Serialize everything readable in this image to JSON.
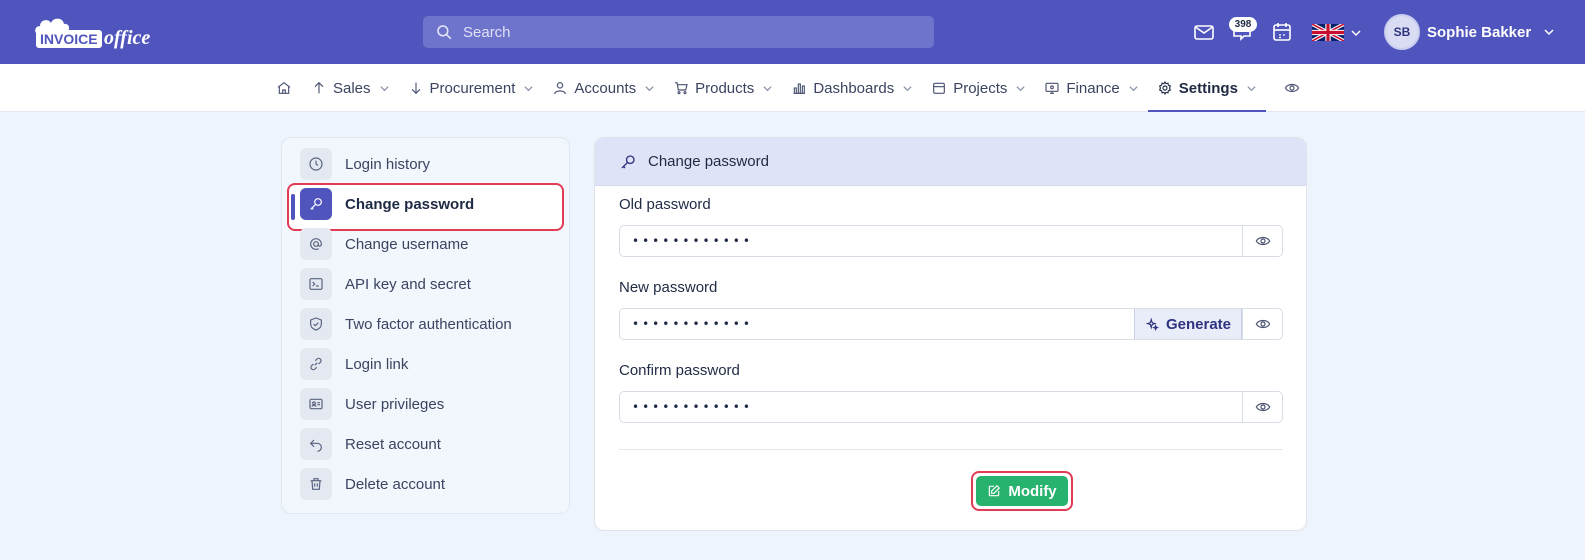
{
  "app": {
    "logo_text_a": "INVOICE",
    "logo_text_b": "office"
  },
  "topbar": {
    "search_placeholder": "Search",
    "notification_count": "398",
    "language": "en-GB",
    "user": {
      "initials": "SB",
      "name": "Sophie Bakker"
    }
  },
  "nav": {
    "items": [
      {
        "label": "Sales",
        "icon": "arrow-up-icon"
      },
      {
        "label": "Procurement",
        "icon": "arrow-down-icon"
      },
      {
        "label": "Accounts",
        "icon": "user-icon"
      },
      {
        "label": "Products",
        "icon": "cart-icon"
      },
      {
        "label": "Dashboards",
        "icon": "bar-chart-icon"
      },
      {
        "label": "Projects",
        "icon": "calendar-icon"
      },
      {
        "label": "Finance",
        "icon": "monitor-icon"
      },
      {
        "label": "Settings",
        "icon": "gear-icon",
        "active": true
      }
    ]
  },
  "sidebar": {
    "items": [
      {
        "label": "Login history",
        "icon": "clock-icon"
      },
      {
        "label": "Change password",
        "icon": "key-icon",
        "active": true
      },
      {
        "label": "Change username",
        "icon": "at-sign-icon"
      },
      {
        "label": "API key and secret",
        "icon": "terminal-icon"
      },
      {
        "label": "Two factor authentication",
        "icon": "shield-icon"
      },
      {
        "label": "Login link",
        "icon": "link-icon"
      },
      {
        "label": "User privileges",
        "icon": "id-card-icon"
      },
      {
        "label": "Reset account",
        "icon": "undo-icon"
      },
      {
        "label": "Delete account",
        "icon": "trash-icon"
      }
    ]
  },
  "form": {
    "title": "Change password",
    "old_password": {
      "label": "Old password",
      "value": "••••••••••••"
    },
    "new_password": {
      "label": "New password",
      "value": "••••••••••••",
      "generate_label": "Generate"
    },
    "confirm_password": {
      "label": "Confirm password",
      "value": "••••••••••••"
    },
    "submit_label": "Modify"
  },
  "colors": {
    "brand": "#4f55bd",
    "accent_green": "#27b26d",
    "highlight_red": "#e23b54",
    "background": "#eef4fb"
  }
}
